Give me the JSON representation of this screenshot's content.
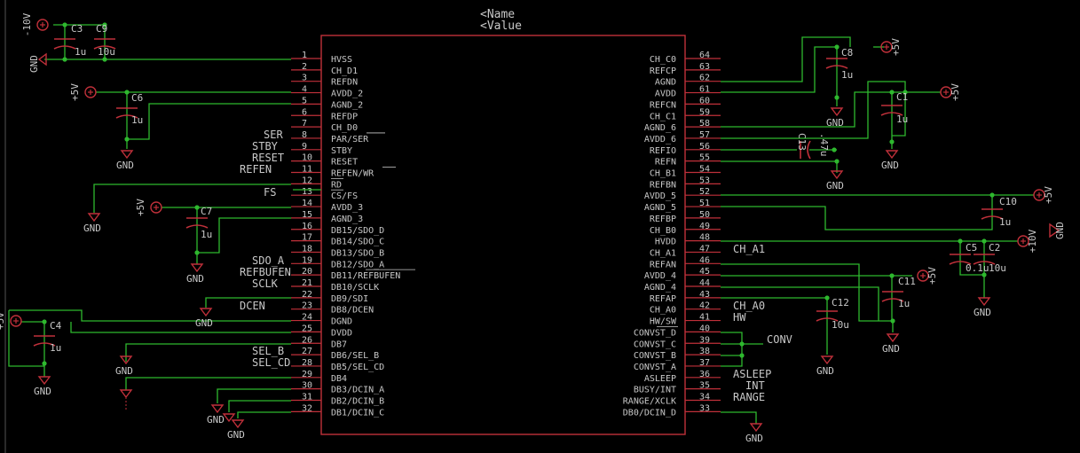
{
  "schematic": {
    "ic": {
      "name": "<Name",
      "value": "<Value",
      "left_pins": [
        {
          "num": "1",
          "label": "HVSS"
        },
        {
          "num": "2",
          "label": "CH_D1"
        },
        {
          "num": "3",
          "label": "REFDN"
        },
        {
          "num": "4",
          "label": "AVDD_2"
        },
        {
          "num": "5",
          "label": "AGND_2"
        },
        {
          "num": "6",
          "label": "REFDP"
        },
        {
          "num": "7",
          "label": "CH_D0"
        },
        {
          "num": "8",
          "label": "PAR/SER"
        },
        {
          "num": "9",
          "label": "STBY"
        },
        {
          "num": "10",
          "label": "RESET"
        },
        {
          "num": "11",
          "label": "REFEN/WR"
        },
        {
          "num": "12",
          "label": "RD"
        },
        {
          "num": "13",
          "label": "CS/FS"
        },
        {
          "num": "14",
          "label": "AVDD_3"
        },
        {
          "num": "15",
          "label": "AGND_3"
        },
        {
          "num": "16",
          "label": "DB15/SDO_D"
        },
        {
          "num": "17",
          "label": "DB14/SDO_C"
        },
        {
          "num": "18",
          "label": "DB13/SDO_B"
        },
        {
          "num": "19",
          "label": "DB12/SDO_A"
        },
        {
          "num": "20",
          "label": "DB11/REFBUFEN"
        },
        {
          "num": "21",
          "label": "DB10/SCLK"
        },
        {
          "num": "22",
          "label": "DB9/SDI"
        },
        {
          "num": "23",
          "label": "DB8/DCEN"
        },
        {
          "num": "24",
          "label": "DGND"
        },
        {
          "num": "25",
          "label": "DVDD"
        },
        {
          "num": "26",
          "label": "DB7"
        },
        {
          "num": "27",
          "label": "DB6/SEL_B"
        },
        {
          "num": "28",
          "label": "DB5/SEL_CD"
        },
        {
          "num": "29",
          "label": "DB4"
        },
        {
          "num": "30",
          "label": "DB3/DCIN_A"
        },
        {
          "num": "31",
          "label": "DB2/DCIN_B"
        },
        {
          "num": "32",
          "label": "DB1/DCIN_C"
        }
      ],
      "right_pins": [
        {
          "num": "64",
          "label": "CH_C0"
        },
        {
          "num": "63",
          "label": "REFCP"
        },
        {
          "num": "62",
          "label": "AGND"
        },
        {
          "num": "61",
          "label": "AVDD"
        },
        {
          "num": "60",
          "label": "REFCN"
        },
        {
          "num": "59",
          "label": "CH_C1"
        },
        {
          "num": "58",
          "label": "AGND_6"
        },
        {
          "num": "57",
          "label": "AVDD_6"
        },
        {
          "num": "56",
          "label": "REFIO"
        },
        {
          "num": "55",
          "label": "REFN"
        },
        {
          "num": "54",
          "label": "CH_B1"
        },
        {
          "num": "53",
          "label": "REFBN"
        },
        {
          "num": "52",
          "label": "AVDD_5"
        },
        {
          "num": "51",
          "label": "AGND_5"
        },
        {
          "num": "50",
          "label": "REFBP"
        },
        {
          "num": "49",
          "label": "CH_B0"
        },
        {
          "num": "48",
          "label": "HVDD"
        },
        {
          "num": "47",
          "label": "CH_A1"
        },
        {
          "num": "46",
          "label": "REFAN"
        },
        {
          "num": "45",
          "label": "AVDD_4"
        },
        {
          "num": "44",
          "label": "AGND_4"
        },
        {
          "num": "43",
          "label": "REFAP"
        },
        {
          "num": "42",
          "label": "CH_A0"
        },
        {
          "num": "41",
          "label": "HW/SW"
        },
        {
          "num": "40",
          "label": "CONVST_D"
        },
        {
          "num": "39",
          "label": "CONVST_C"
        },
        {
          "num": "38",
          "label": "CONVST_B"
        },
        {
          "num": "37",
          "label": "CONVST_A"
        },
        {
          "num": "36",
          "label": "ASLEEP"
        },
        {
          "num": "35",
          "label": "BUSY/INT"
        },
        {
          "num": "34",
          "label": "RANGE/XCLK"
        },
        {
          "num": "33",
          "label": "DB0/DCIN_D"
        }
      ]
    },
    "net_labels": {
      "ser": "SER",
      "stby": "STBY",
      "reset": "RESET",
      "refen": "REFEN",
      "fs": "FS",
      "sdo_a": "SDO_A",
      "refbufen": "REFBUFEN",
      "sclk": "SCLK",
      "dcen": "DCEN",
      "sel_b": "SEL_B",
      "sel_cd": "SEL_CD",
      "ch_a1": "CH_A1",
      "ch_a0": "CH_A0",
      "hw": "HW",
      "conv": "CONV",
      "asleep": "ASLEEP",
      "int": "INT",
      "range": "RANGE"
    },
    "parts": {
      "c3": "C3",
      "c9": "C9",
      "c3_val": "1u",
      "c9_val": "10u",
      "c6": "C6",
      "c6_val": "1u",
      "c7": "C7",
      "c7_val": "1u",
      "c4": "C4",
      "c4_val": "1u",
      "c8": "C8",
      "c8_val": "1u",
      "c1": "C1",
      "c1_val": "1u",
      "c13": "C13",
      "c13_val": ".47u",
      "c10": "C10",
      "c10_val": "1u",
      "c5": "C5",
      "c5_val": "0.1u",
      "c2": "C2",
      "c2_val": "10u",
      "c11": "C11",
      "c11_val": "1u",
      "c12": "C12",
      "c12_val": "10u"
    },
    "power": {
      "gnd": "GND",
      "p5v": "+5V",
      "m10v": "-10V",
      "p10v": "+10V"
    },
    "colors": {
      "wire": "#2eb82e",
      "part": "#c0303a",
      "text": "#c8c8c8",
      "bg": "#000000"
    }
  }
}
